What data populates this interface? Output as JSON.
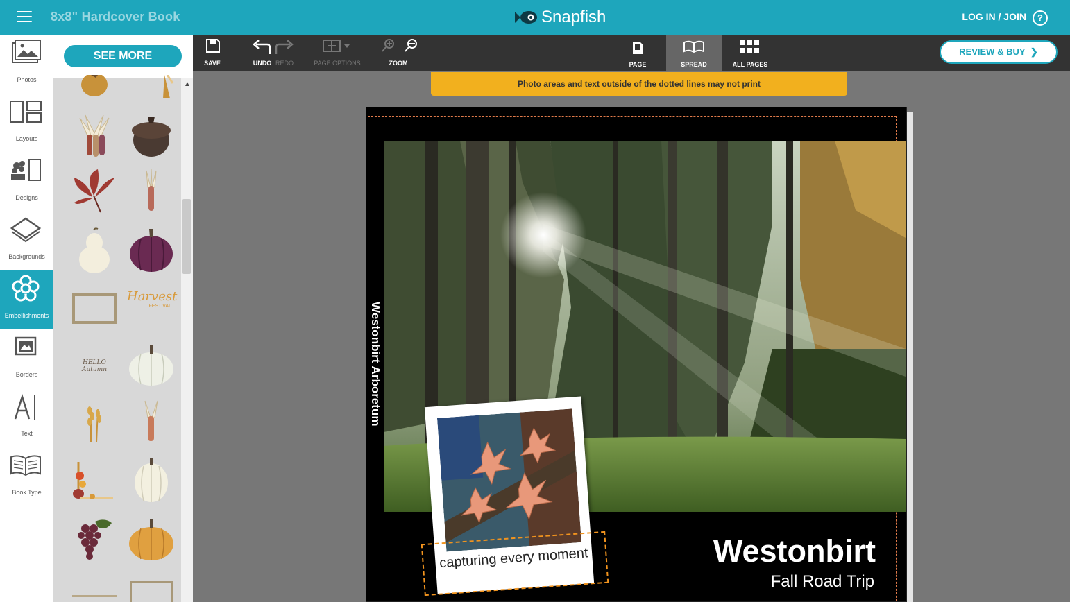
{
  "header": {
    "doc_title": "8x8\" Hardcover Book",
    "brand": "Snapfish",
    "login": "LOG IN / JOIN",
    "help": "?"
  },
  "rail": {
    "items": [
      {
        "label": "Photos",
        "icon": "photos-icon"
      },
      {
        "label": "Layouts",
        "icon": "layouts-icon"
      },
      {
        "label": "Designs",
        "icon": "designs-icon"
      },
      {
        "label": "Backgrounds",
        "icon": "backgrounds-icon"
      },
      {
        "label": "Embellishments",
        "icon": "flower-icon",
        "active": true
      },
      {
        "label": "Borders",
        "icon": "borders-icon"
      },
      {
        "label": "Text",
        "icon": "text-icon"
      },
      {
        "label": "Book Type",
        "icon": "book-icon"
      }
    ]
  },
  "panel": {
    "see_more": "SEE MORE",
    "harvest_title": "Harvest",
    "harvest_sub": "FESTIVAL",
    "hello_autumn": "HELLO Autumn"
  },
  "toolbar": {
    "save": "SAVE",
    "undo": "UNDO",
    "redo": "REDO",
    "page_options": "PAGE OPTIONS",
    "zoom": "ZOOM",
    "page": "PAGE",
    "spread": "SPREAD",
    "all_pages": "ALL PAGES",
    "review_buy": "REVIEW & BUY"
  },
  "warning": "Photo areas and text outside of the dotted lines may not print",
  "book": {
    "spine": "Westonbirt Arboretum",
    "caption": "capturing every moment",
    "title": "Westonbirt",
    "subtitle": "Fall Road Trip"
  },
  "colors": {
    "accent": "#1ea6bc",
    "warning": "#f2b01e",
    "toolbar": "#333333"
  }
}
